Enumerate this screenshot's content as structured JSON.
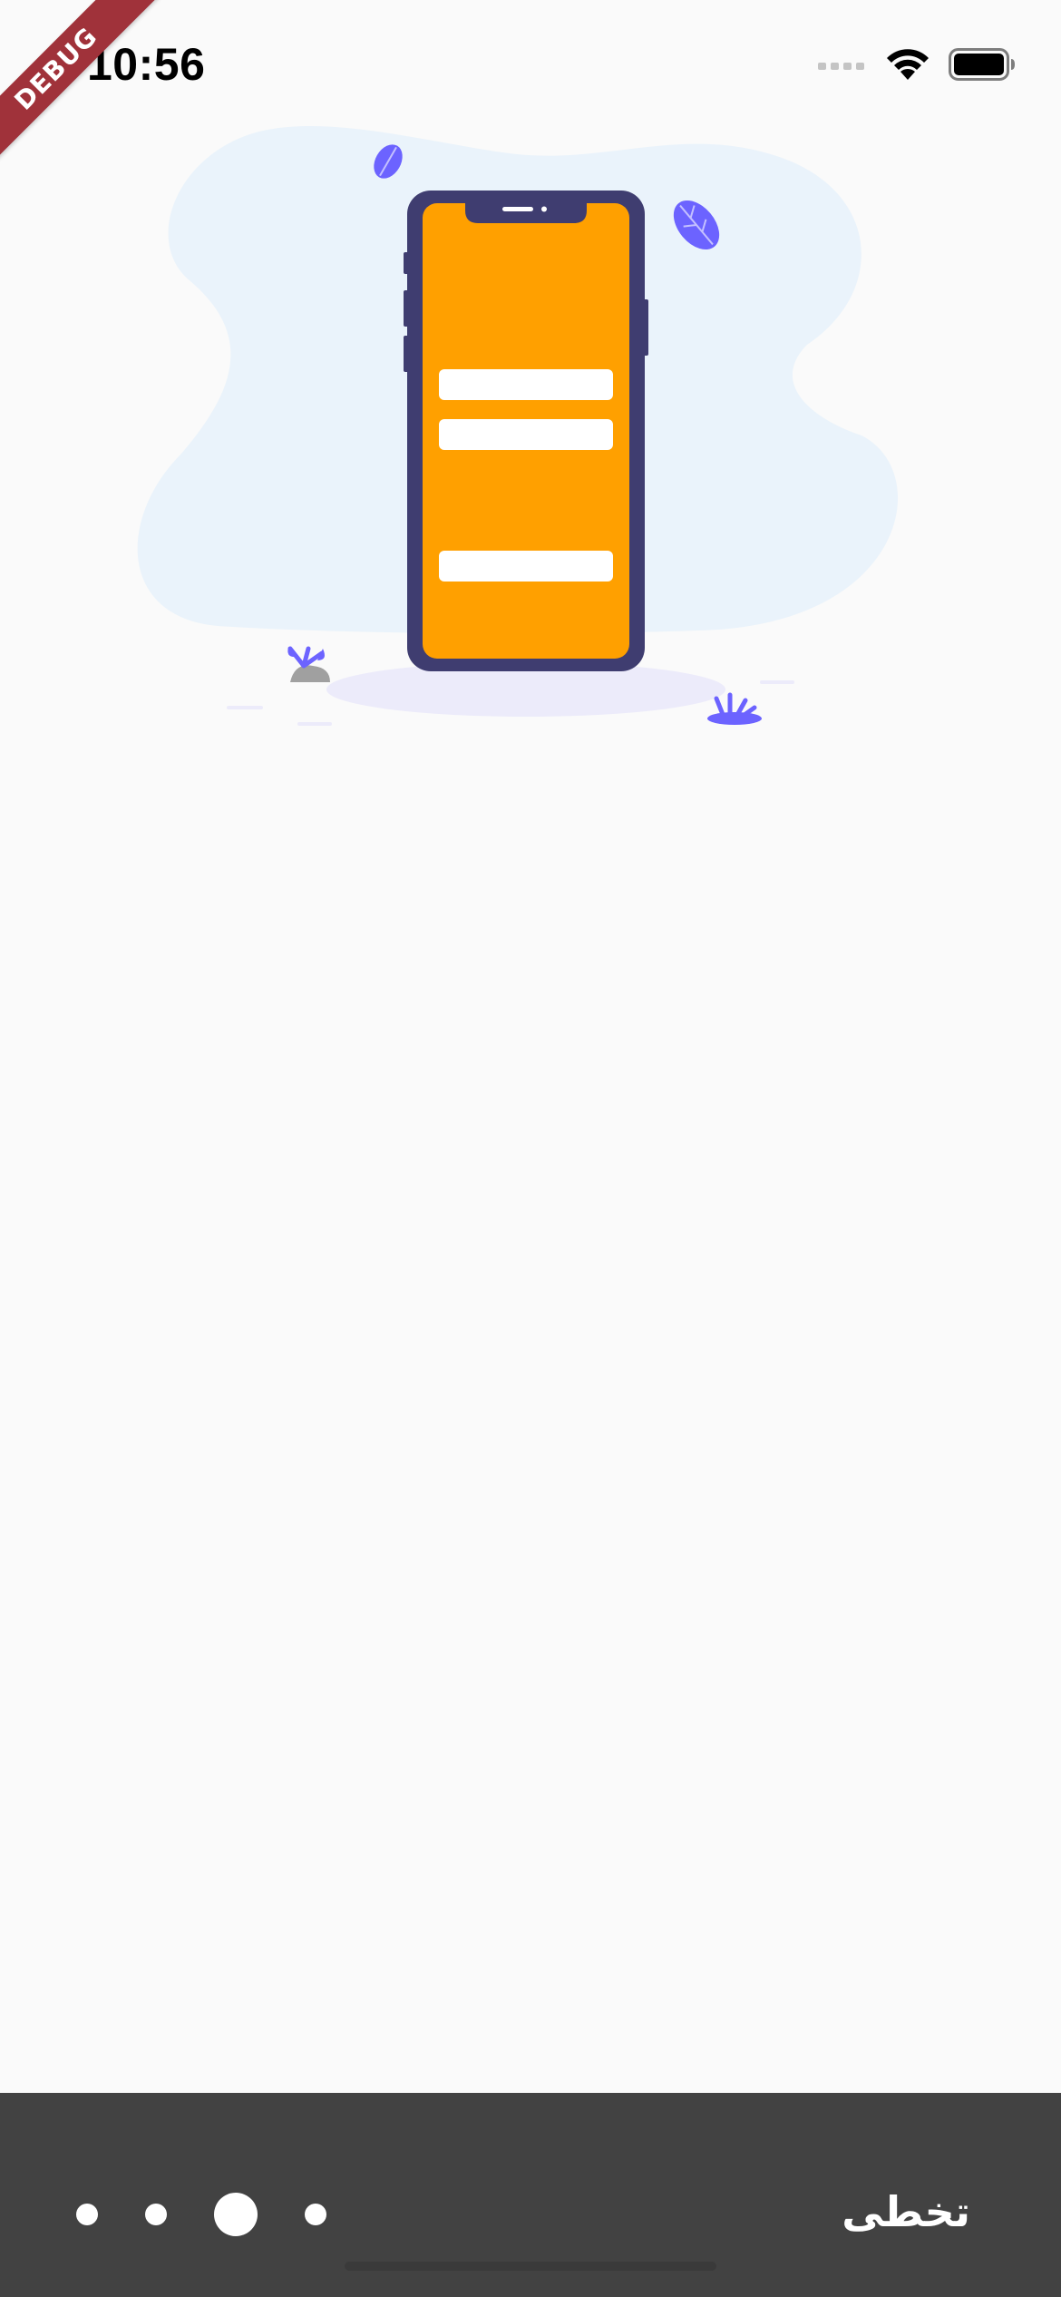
{
  "status_bar": {
    "time": "10:56",
    "icons": [
      "signal-icon",
      "wifi-icon",
      "battery-icon"
    ]
  },
  "debug_banner": {
    "label": "DEBUG",
    "color": "#A0323A"
  },
  "onboarding": {
    "illustration": "phone-illustration",
    "colors": {
      "background": "#FAFAFA",
      "blob": "#EAF3FB",
      "phone_frame": "#3F3D70",
      "phone_screen": "#FFA000",
      "accent": "#6C63FF"
    },
    "pagination": {
      "total": 4,
      "active_index": 2
    }
  },
  "bottom_bar": {
    "skip_label": "تخطى",
    "background": "#424242"
  }
}
